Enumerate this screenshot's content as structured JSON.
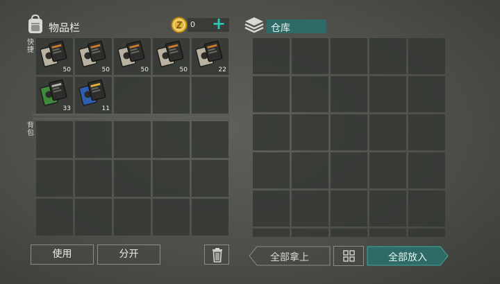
{
  "inventory": {
    "title": "物品栏",
    "coin_count": "0",
    "plus_icon": "plus-icon",
    "quick_label": "快捷",
    "pack_label": "背包",
    "quick_items": [
      {
        "icon": "book-item",
        "count": "50"
      },
      {
        "icon": "book-item",
        "count": "50"
      },
      {
        "icon": "book-item",
        "count": "50"
      },
      {
        "icon": "book-item",
        "count": "50"
      },
      {
        "icon": "book-item",
        "count": "22"
      },
      {
        "icon": "green-book-item",
        "count": "33"
      },
      {
        "icon": "blue-book-item",
        "count": "11"
      }
    ]
  },
  "warehouse": {
    "name": "仓库"
  },
  "actions": {
    "use": "使用",
    "split": "分开",
    "take_all": "全部拿上",
    "put_all": "全部放入"
  },
  "colors": {
    "accent": "#2ec6b8",
    "warehouse_tag": "#2f6b66",
    "put_all_fill": "#2f6b66",
    "coin": "#e3b43a"
  }
}
